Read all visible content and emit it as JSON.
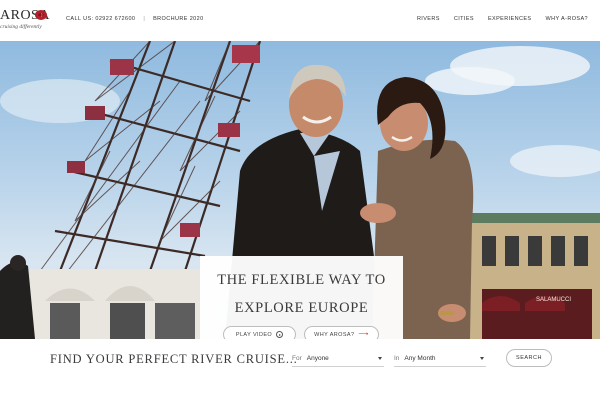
{
  "brand": {
    "logo_text": "AROSA",
    "tagline": "cruising differently",
    "accent": "#b3202a"
  },
  "header": {
    "call_label": "CALL US:",
    "phone": "02922 672600",
    "brochure_link": "BROCHURE 2020",
    "nav": [
      {
        "label": "RIVERS"
      },
      {
        "label": "CITIES"
      },
      {
        "label": "EXPERIENCES"
      },
      {
        "label": "WHY A-ROSA?"
      }
    ]
  },
  "hero": {
    "headline_line1": "THE FLEXIBLE WAY TO",
    "headline_line2": "EXPLORE EUROPE",
    "play_button": "PLAY VIDEO",
    "why_button": "WHY AROSA?",
    "shop_sign": "SALAMUCCI",
    "icons": [
      "play-circle-icon",
      "arrow-right-icon"
    ]
  },
  "search": {
    "title": "FIND YOUR PERFECT RIVER CRUISE...",
    "who_prefix": "For",
    "who_value": "Anyone",
    "when_prefix": "In",
    "when_value": "Any Month",
    "button": "SEARCH",
    "icons": [
      "chevron-down-icon"
    ]
  }
}
